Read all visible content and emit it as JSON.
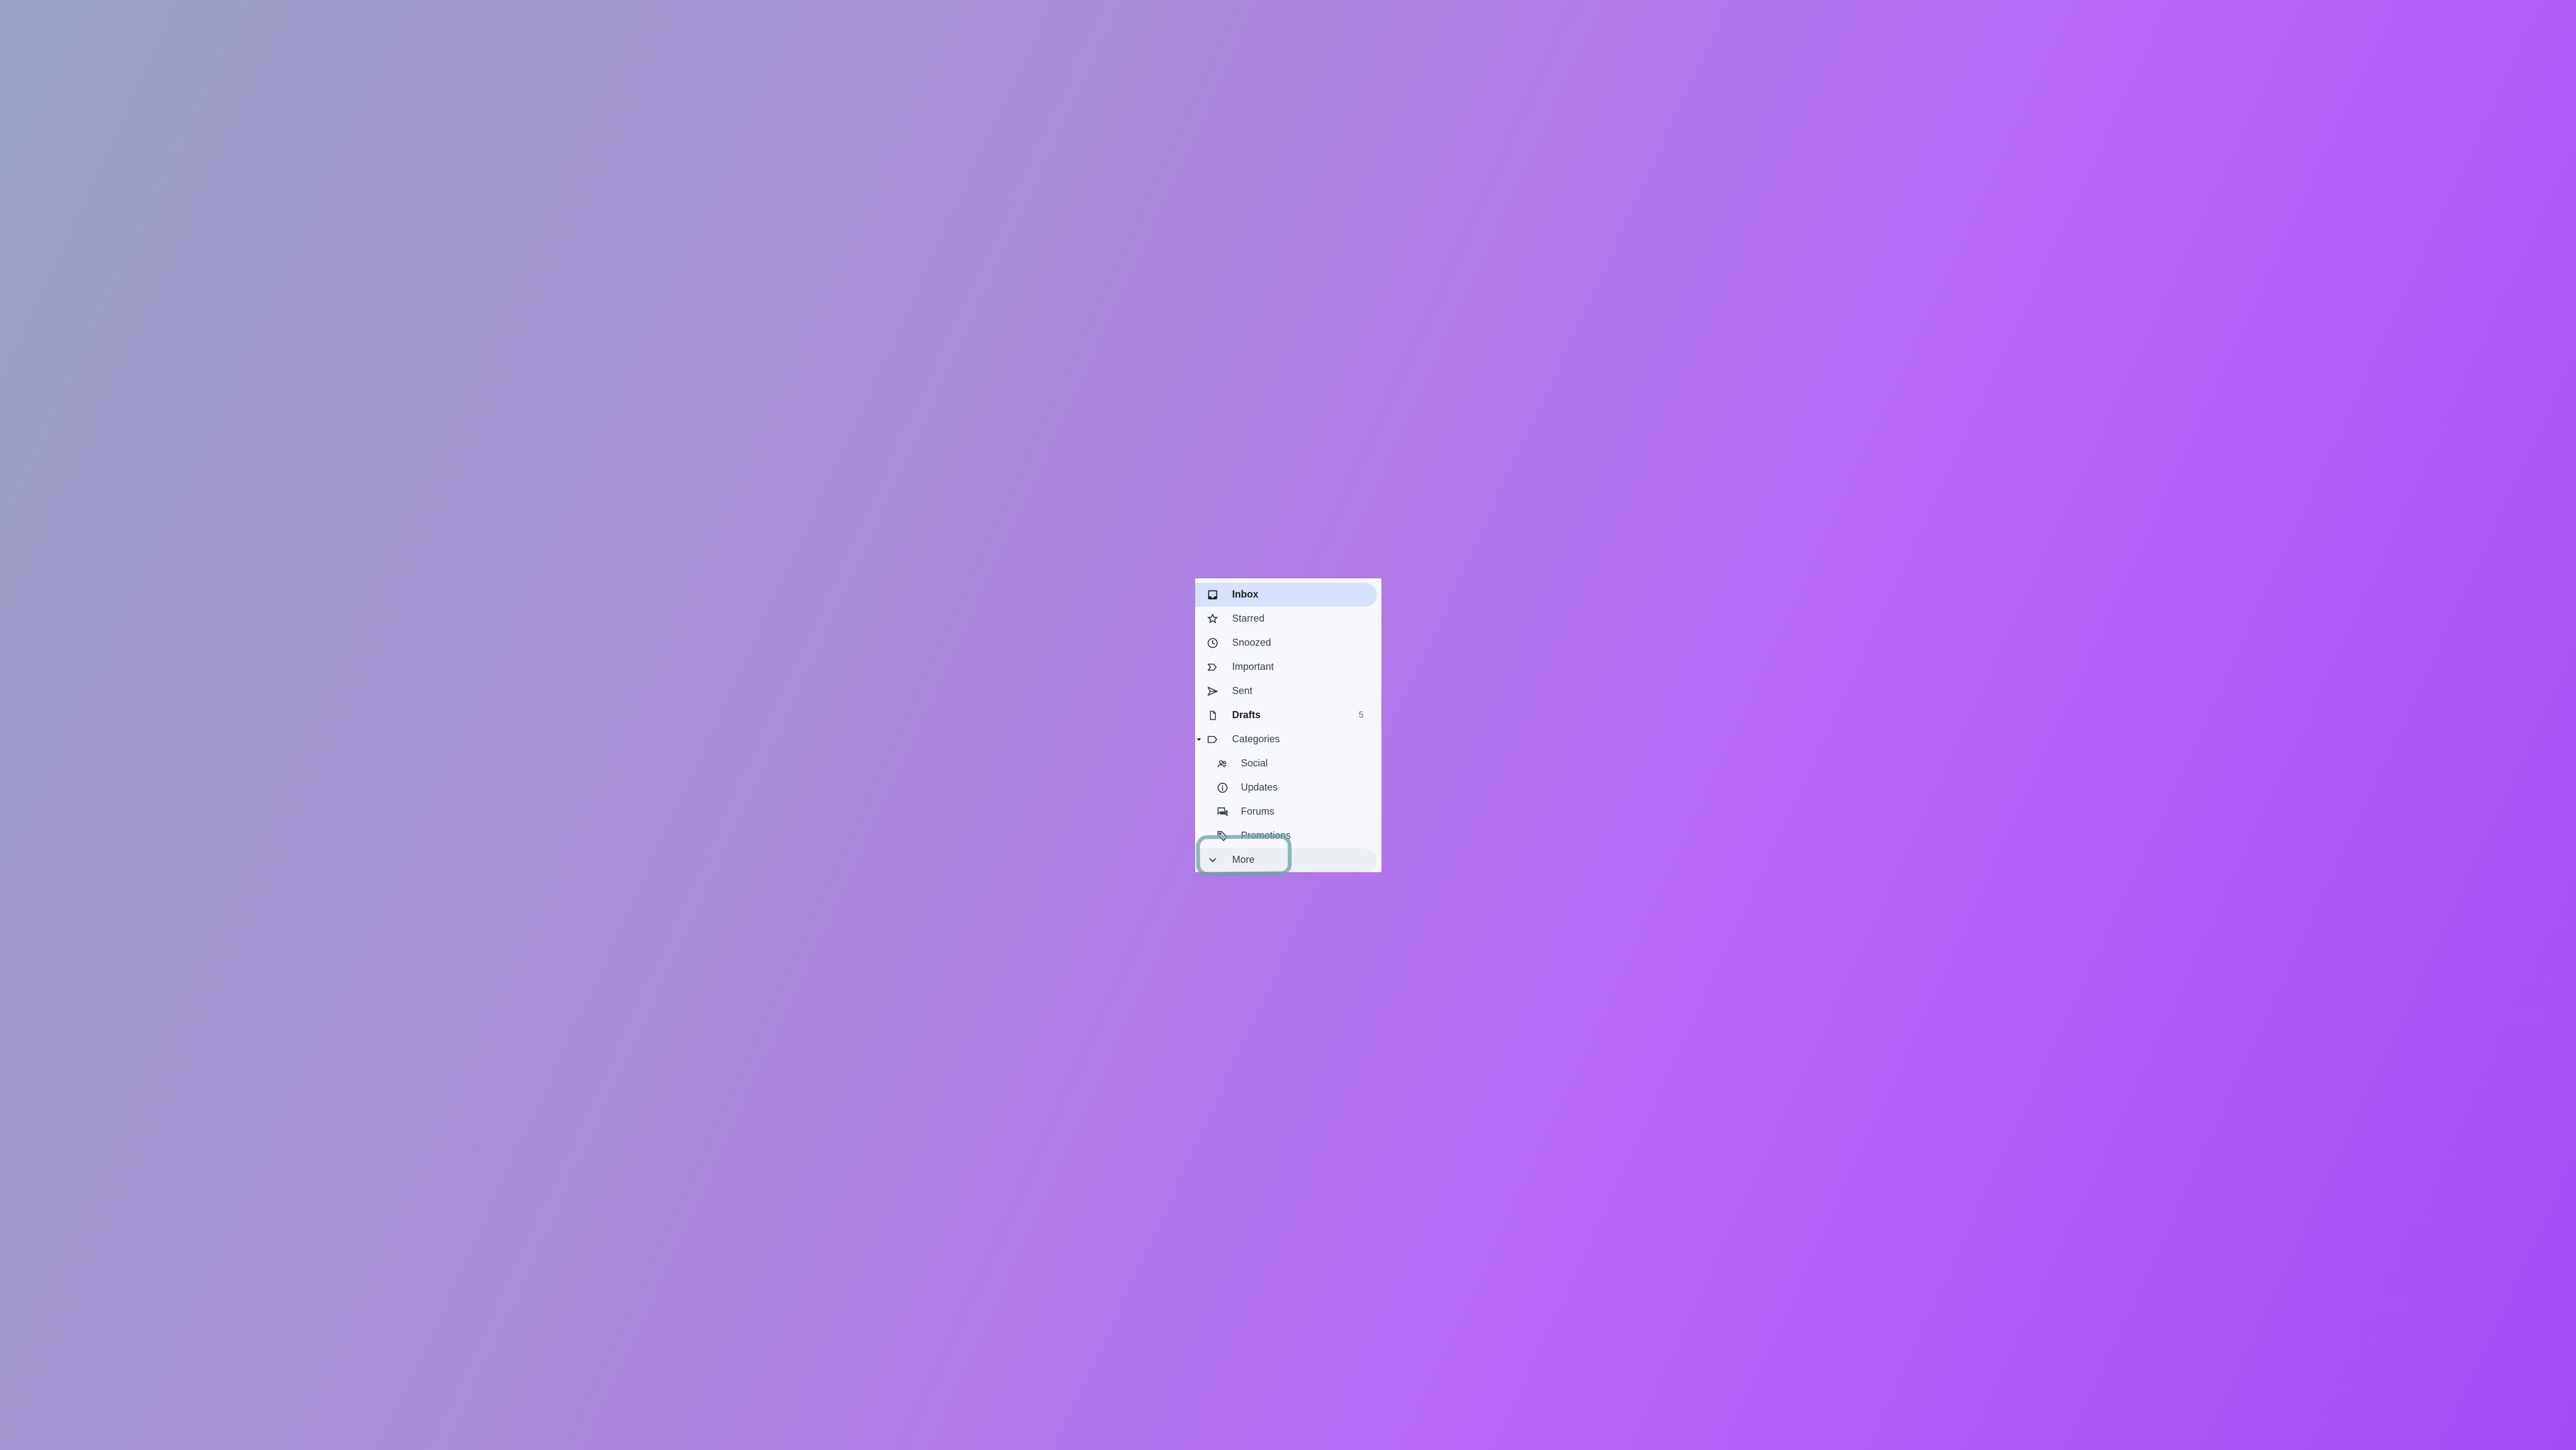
{
  "sidebar": {
    "items": [
      {
        "label": "Inbox",
        "icon": "inbox-icon",
        "selected": true
      },
      {
        "label": "Starred",
        "icon": "star-icon"
      },
      {
        "label": "Snoozed",
        "icon": "clock-icon"
      },
      {
        "label": "Important",
        "icon": "important-icon"
      },
      {
        "label": "Sent",
        "icon": "send-icon"
      },
      {
        "label": "Drafts",
        "icon": "file-icon",
        "bold": true,
        "count": "5"
      },
      {
        "label": "Categories",
        "icon": "label-icon",
        "expandable": true
      }
    ],
    "categories": [
      {
        "label": "Social",
        "icon": "people-icon"
      },
      {
        "label": "Updates",
        "icon": "info-icon"
      },
      {
        "label": "Forums",
        "icon": "forum-icon"
      },
      {
        "label": "Promotions",
        "icon": "tag-icon"
      }
    ],
    "more": {
      "label": "More",
      "icon": "chevron-down-icon",
      "hovered": true,
      "highlighted": true
    }
  }
}
